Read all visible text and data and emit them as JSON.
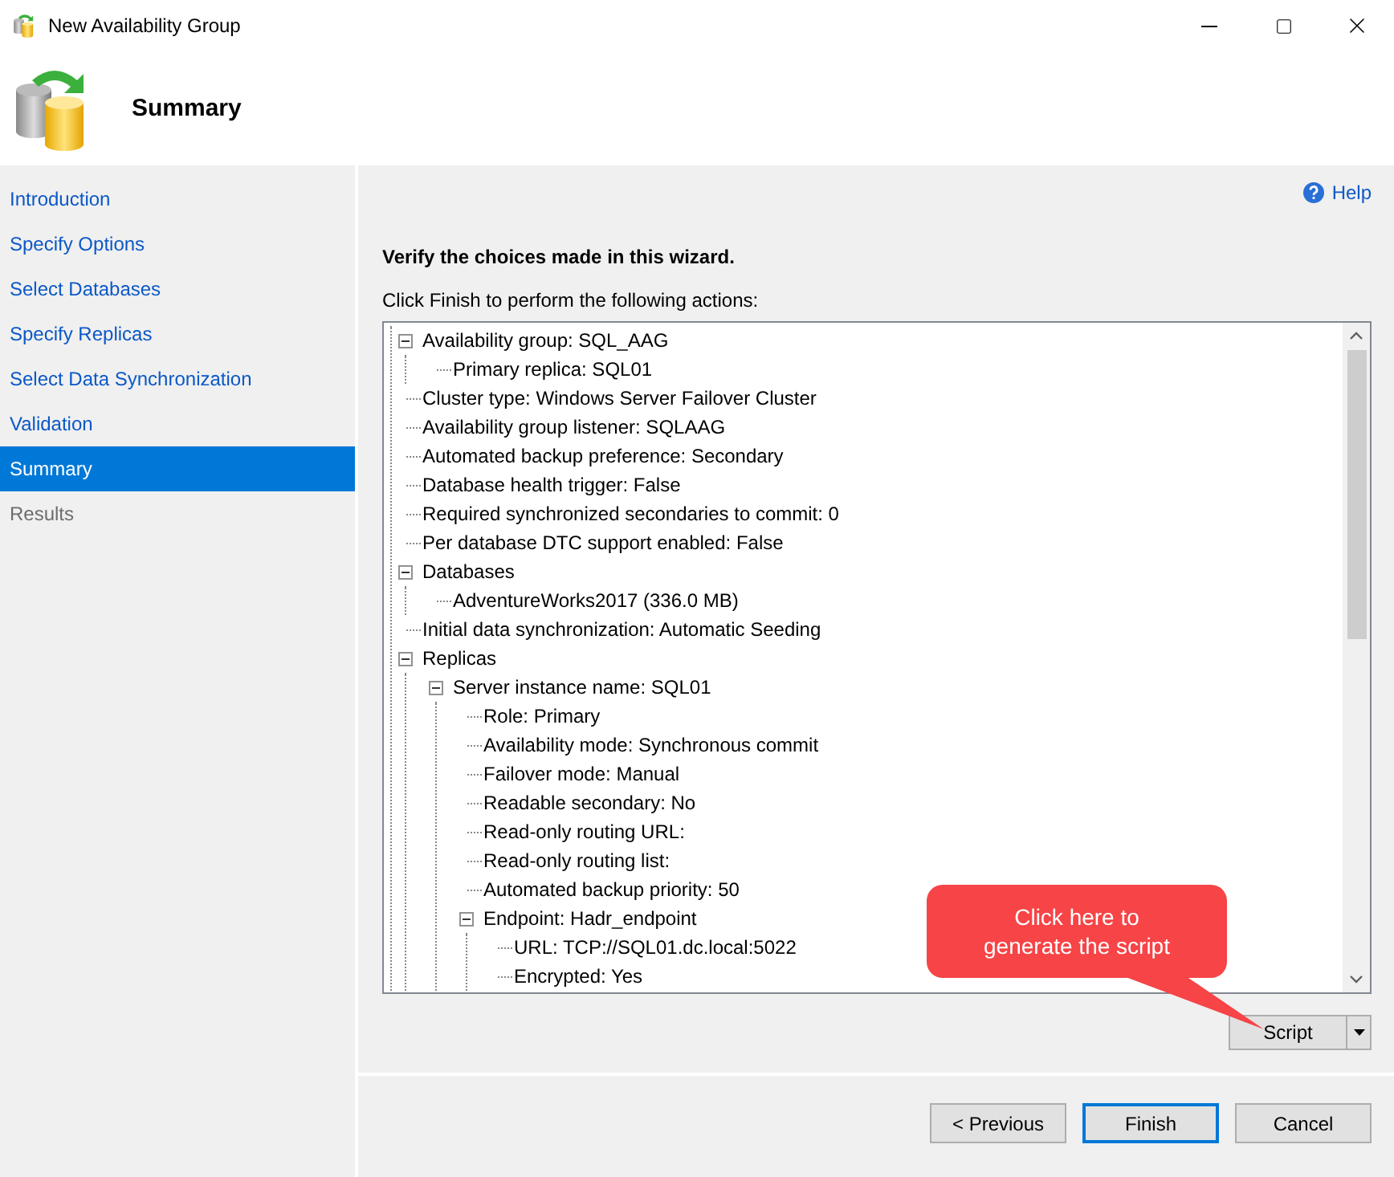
{
  "window": {
    "title": "New Availability Group"
  },
  "header": {
    "title": "Summary"
  },
  "sidebar": {
    "items": [
      {
        "label": "Introduction",
        "selected": false,
        "disabled": false
      },
      {
        "label": "Specify Options",
        "selected": false,
        "disabled": false
      },
      {
        "label": "Select Databases",
        "selected": false,
        "disabled": false
      },
      {
        "label": "Specify Replicas",
        "selected": false,
        "disabled": false
      },
      {
        "label": "Select Data Synchronization",
        "selected": false,
        "disabled": false
      },
      {
        "label": "Validation",
        "selected": false,
        "disabled": false
      },
      {
        "label": "Summary",
        "selected": true,
        "disabled": false
      },
      {
        "label": "Results",
        "selected": false,
        "disabled": true
      }
    ]
  },
  "help": {
    "label": "Help"
  },
  "heading": "Verify the choices made in this wizard.",
  "instruction": "Click Finish to perform the following actions:",
  "tree": [
    {
      "text": "Availability group: SQL_AAG",
      "expanded": true,
      "children": [
        {
          "text": "Primary replica: SQL01"
        }
      ]
    },
    {
      "text": "Cluster type: Windows Server Failover Cluster"
    },
    {
      "text": "Availability group listener: SQLAAG"
    },
    {
      "text": "Automated backup preference: Secondary"
    },
    {
      "text": "Database health trigger: False"
    },
    {
      "text": "Required synchronized secondaries to commit: 0"
    },
    {
      "text": "Per database DTC support enabled: False"
    },
    {
      "text": "Databases",
      "expanded": true,
      "children": [
        {
          "text": "AdventureWorks2017 (336.0 MB)"
        }
      ]
    },
    {
      "text": "Initial data synchronization: Automatic Seeding"
    },
    {
      "text": "Replicas",
      "expanded": true,
      "children": [
        {
          "text": "Server instance name: SQL01",
          "expanded": true,
          "children": [
            {
              "text": "Role: Primary"
            },
            {
              "text": "Availability mode: Synchronous commit"
            },
            {
              "text": "Failover mode: Manual"
            },
            {
              "text": "Readable secondary: No"
            },
            {
              "text": "Read-only routing URL:"
            },
            {
              "text": "Read-only routing list:"
            },
            {
              "text": "Automated backup priority: 50"
            },
            {
              "text": "Endpoint: Hadr_endpoint",
              "expanded": true,
              "children": [
                {
                  "text": "URL: TCP://SQL01.dc.local:5022"
                },
                {
                  "text": "Encrypted: Yes"
                }
              ]
            }
          ]
        }
      ]
    }
  ],
  "callout": {
    "text": "Click here to generate the script"
  },
  "script_button": {
    "label": "Script"
  },
  "buttons": [
    {
      "label": "< Previous",
      "default": false
    },
    {
      "label": "Finish",
      "default": true
    },
    {
      "label": "Cancel",
      "default": false
    }
  ]
}
